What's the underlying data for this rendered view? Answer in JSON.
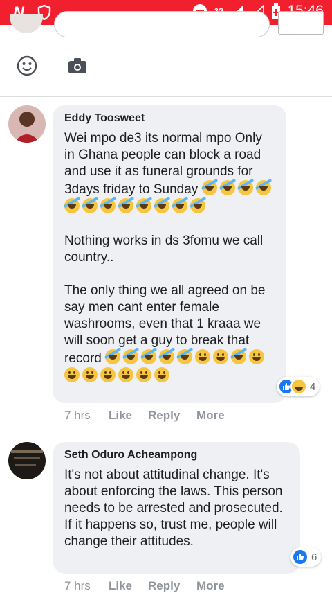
{
  "status_bar": {
    "time": "15:46",
    "network": "3G",
    "colors": {
      "background": "#f2202e"
    }
  },
  "composer": {
    "icons": [
      "emoji-icon",
      "camera-icon"
    ]
  },
  "comments": [
    {
      "author": "Eddy Toosweet",
      "paragraphs": [
        "Wei mpo de3 its normal mpo Only in Ghana people can block a road and use it as funeral grounds for 3days friday to Sunday",
        "Nothing works in ds 3fomu we call country..",
        "The only thing we all agreed on be say men cant enter female washrooms, even that 1 kraaa we will soon get a guy to break that record"
      ],
      "reaction_count": "4",
      "time": "7 hrs",
      "like_label": "Like",
      "reply_label": "Reply",
      "more_label": "More"
    },
    {
      "author": "Seth Oduro Acheampong",
      "paragraphs": [
        "It's not about attitudinal change. It's about enforcing the laws. This person needs to be arrested and prosecuted. If it happens so, trust me, people will change their attitudes."
      ],
      "reaction_count": "6",
      "time": "7 hrs",
      "like_label": "Like",
      "reply_label": "Reply",
      "more_label": "More"
    }
  ]
}
